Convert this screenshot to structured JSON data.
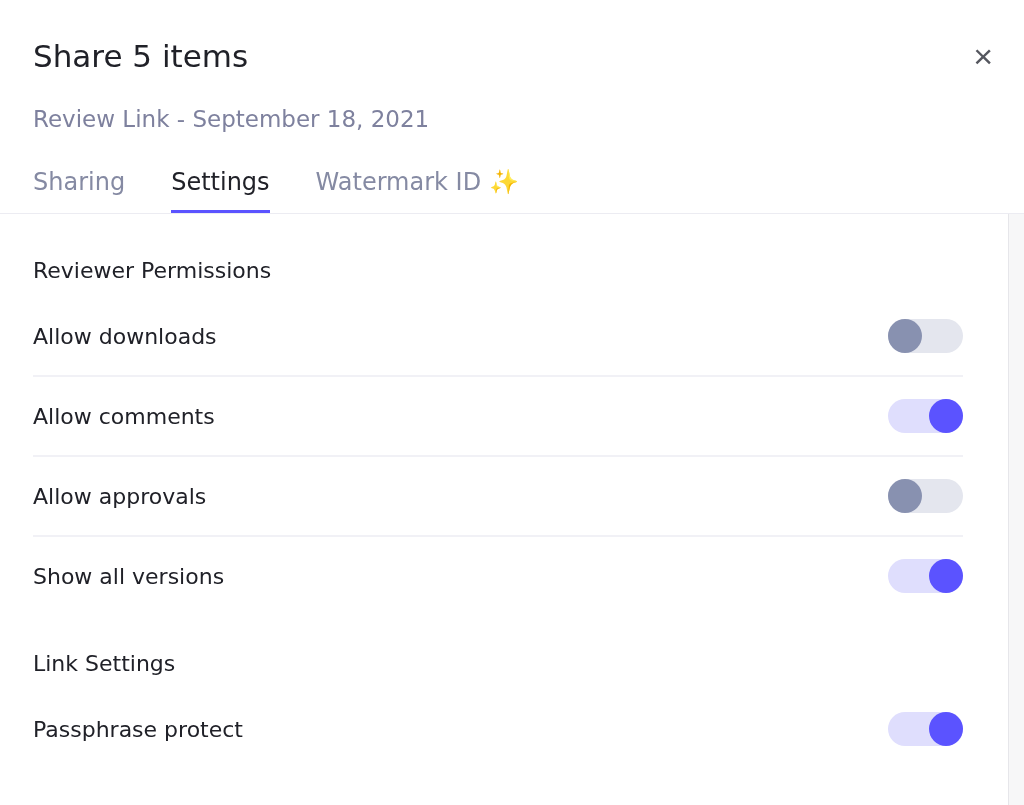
{
  "dialog": {
    "title": "Share 5 items",
    "subtitle": "Review Link - September 18, 2021",
    "close": "×"
  },
  "tabs": [
    {
      "label": "Sharing",
      "selected": false
    },
    {
      "label": "Settings",
      "selected": true
    },
    {
      "label": "Watermark ID ✨",
      "selected": false
    }
  ],
  "sections": [
    {
      "heading": "Reviewer Permissions",
      "rows": [
        {
          "label": "Allow downloads",
          "on": false
        },
        {
          "label": "Allow comments",
          "on": true
        },
        {
          "label": "Allow approvals",
          "on": false
        },
        {
          "label": "Show all versions",
          "on": true
        }
      ]
    },
    {
      "heading": "Link Settings",
      "rows": [
        {
          "label": "Passphrase protect",
          "on": true
        }
      ]
    }
  ]
}
